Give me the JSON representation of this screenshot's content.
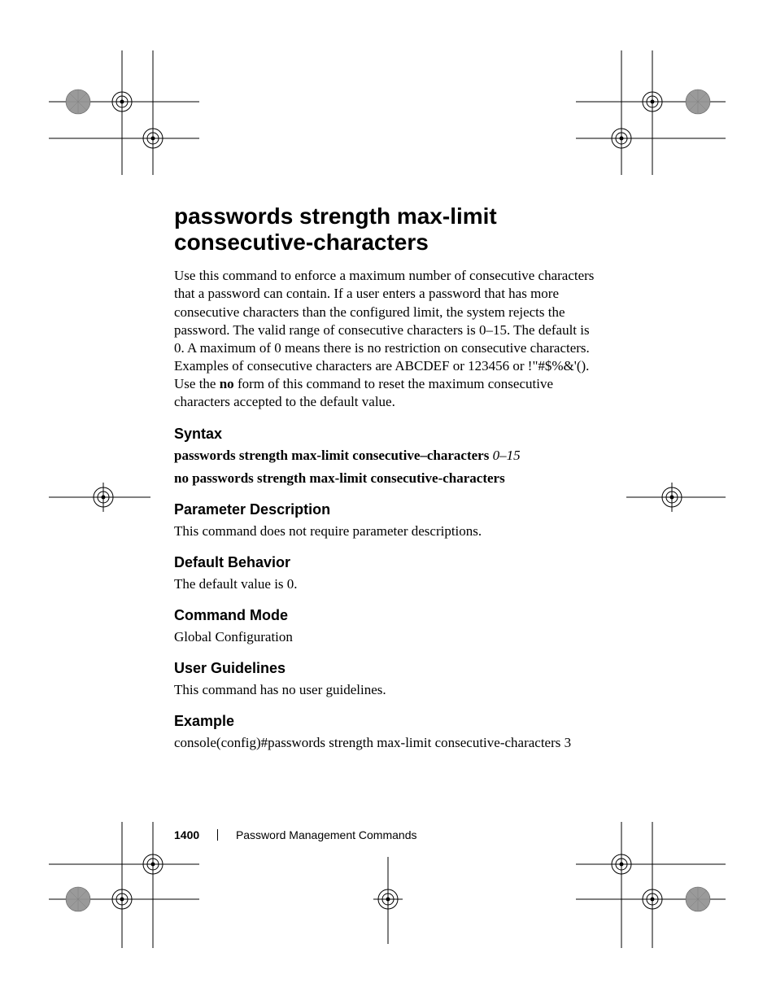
{
  "heading": "passwords strength max-limit consecutive-characters",
  "description_html": "Use this command to enforce a maximum number of consecutive characters that a password can contain. If a user enters a password that has more consecutive characters than the configured limit, the system rejects the password. The valid range of consecutive characters is 0–15. The default is 0. A maximum of 0 means there is no restriction on consecutive characters. Examples of consecutive characters are ABCDEF or 123456 or !\"#$%&'(). Use the <b>no</b> form of this command to reset the maximum consecutive characters accepted to the default value.",
  "sections": {
    "syntax": {
      "label": "Syntax",
      "line1_cmd": "passwords strength max-limit consecutive–characters",
      "line1_arg": "0–15",
      "line2": "no passwords strength max-limit consecutive-characters"
    },
    "param_desc": {
      "label": "Parameter Description",
      "text": "This command does not require parameter descriptions."
    },
    "default_behavior": {
      "label": "Default Behavior",
      "text": "The default value is 0."
    },
    "command_mode": {
      "label": "Command Mode",
      "text": "Global Configuration"
    },
    "user_guidelines": {
      "label": "User Guidelines",
      "text": "This command has no user guidelines."
    },
    "example": {
      "label": "Example",
      "text": "console(config)#passwords strength max-limit consecutive-characters 3"
    }
  },
  "footer": {
    "page_number": "1400",
    "section": "Password Management Commands"
  }
}
